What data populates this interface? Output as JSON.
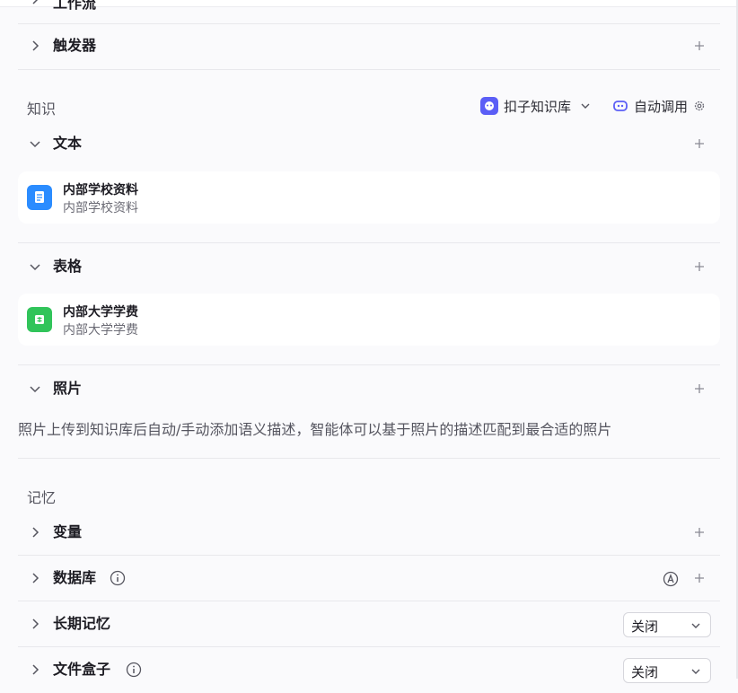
{
  "workflow": {
    "title": "工作流"
  },
  "trigger": {
    "title": "触发器"
  },
  "knowledge": {
    "label": "知识",
    "kb_picker": {
      "label": "扣子知识库"
    },
    "auto_call": {
      "label": "自动调用"
    },
    "text": {
      "title": "文本",
      "items": [
        {
          "name": "内部学校资料",
          "desc": "内部学校资料"
        }
      ]
    },
    "table": {
      "title": "表格",
      "items": [
        {
          "name": "内部大学学费",
          "desc": "内部大学学费"
        }
      ]
    },
    "photo": {
      "title": "照片",
      "desc": "照片上传到知识库后自动/手动添加语义描述，智能体可以基于照片的描述匹配到最合适的照片"
    }
  },
  "memory": {
    "label": "记忆",
    "variables": {
      "title": "变量"
    },
    "database": {
      "title": "数据库"
    },
    "long_term": {
      "title": "长期记忆",
      "value": "关闭"
    },
    "file_box": {
      "title": "文件盒子",
      "value": "关闭"
    }
  },
  "colors": {
    "doc_icon": "#2b8cff",
    "table_icon": "#31c45a",
    "kb_logo": "#5b5ef6"
  }
}
